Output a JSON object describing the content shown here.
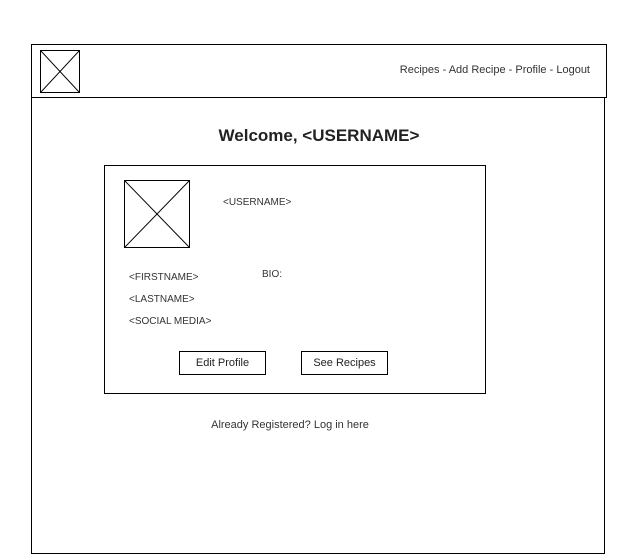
{
  "header": {
    "nav": {
      "recipes": "Recipes",
      "add_recipe": "Add Recipe",
      "profile": "Profile",
      "logout": "Logout",
      "separator": " - "
    }
  },
  "main": {
    "welcome": "Welcome, <USERNAME>"
  },
  "profile_card": {
    "username": "<USERNAME>",
    "firstname": "<FIRSTNAME>",
    "lastname": "<LASTNAME>",
    "social_media": "<SOCIAL MEDIA>",
    "bio_label": "BIO:",
    "edit_profile": "Edit Profile",
    "see_recipes": "See Recipes"
  },
  "footer": {
    "login_link": "Already Registered? Log in here"
  },
  "icons": {
    "logo": "image-placeholder-icon",
    "avatar": "image-placeholder-icon"
  }
}
